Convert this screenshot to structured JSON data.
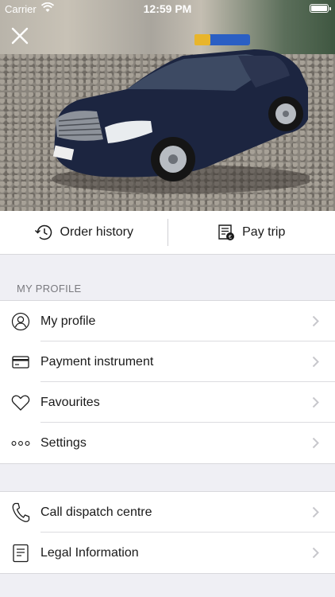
{
  "status_bar": {
    "carrier": "Carrier",
    "time": "12:59 PM"
  },
  "header": {
    "close_icon": "close-icon",
    "hero_image": "taxi-car-photo"
  },
  "actions": {
    "order_history": {
      "label": "Order history",
      "icon": "history-clock-icon"
    },
    "pay_trip": {
      "label": "Pay trip",
      "icon": "receipt-icon"
    }
  },
  "profile_section": {
    "header": "MY PROFILE",
    "items": [
      {
        "label": "My profile",
        "icon": "user-icon"
      },
      {
        "label": "Payment instrument",
        "icon": "credit-card-icon"
      },
      {
        "label": "Favourites",
        "icon": "heart-icon"
      },
      {
        "label": "Settings",
        "icon": "more-dots-icon"
      }
    ]
  },
  "support_section": {
    "items": [
      {
        "label": "Call dispatch centre",
        "icon": "phone-icon"
      },
      {
        "label": "Legal Information",
        "icon": "document-icon"
      }
    ]
  },
  "colors": {
    "background": "#efeff4",
    "cell": "#ffffff",
    "separator": "#d8d8dc",
    "section_header": "#7a7a7f",
    "chevron": "#c7c7cc"
  }
}
